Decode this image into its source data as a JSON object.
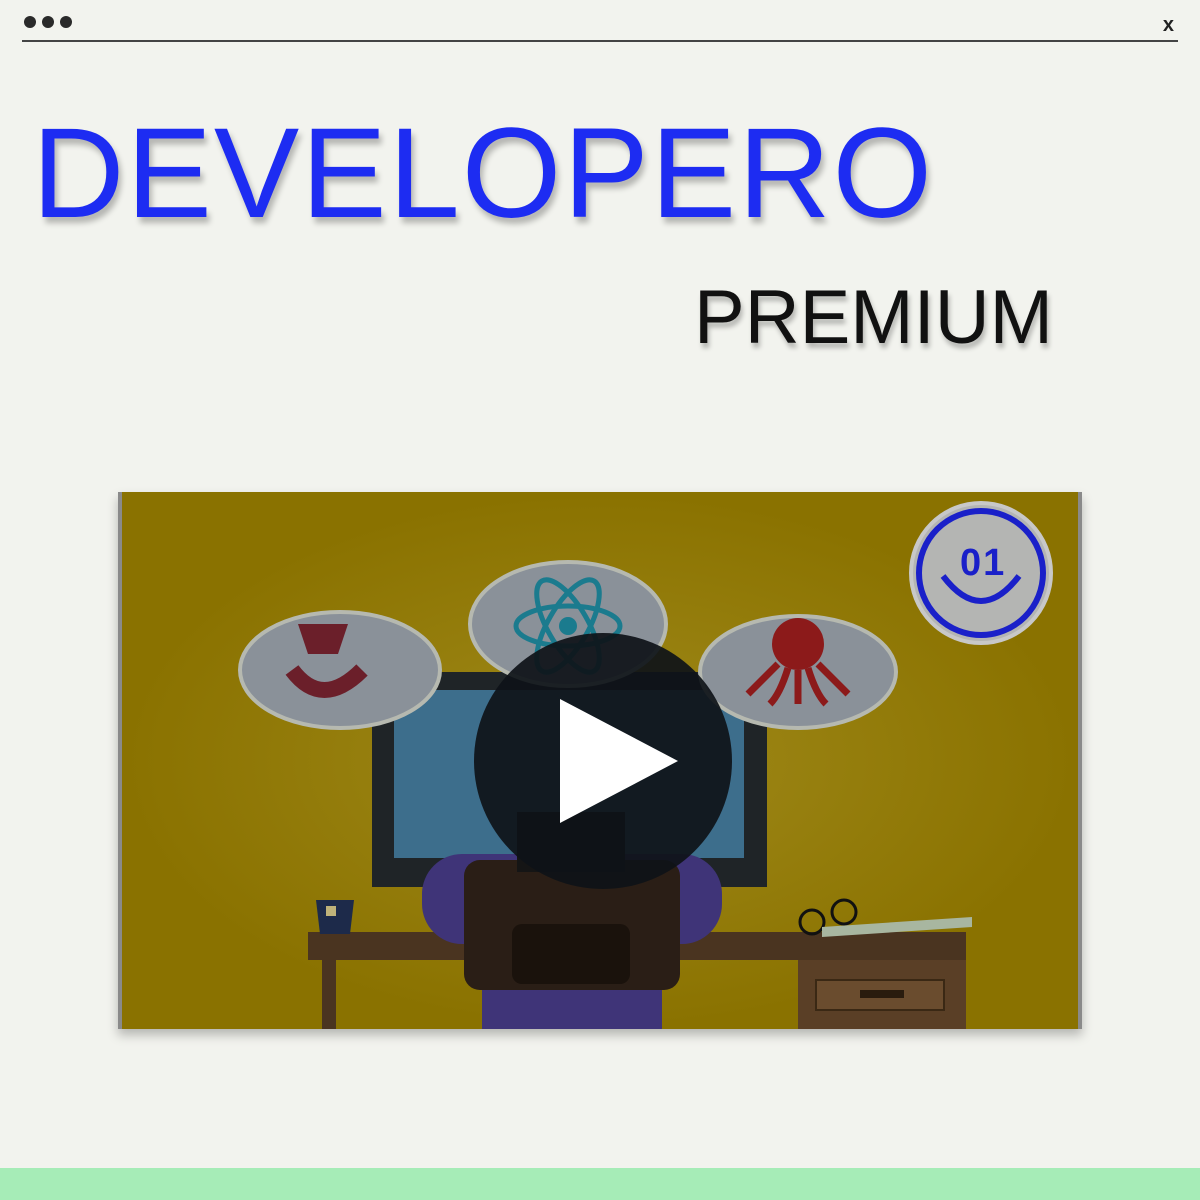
{
  "window": {
    "close_label": "x"
  },
  "hero": {
    "title": "DEVELOPERO",
    "subtitle": "PREMIUM"
  },
  "video": {
    "badge": "01"
  },
  "colors": {
    "brand": "#1d2cf2",
    "video_bg": "#8a7200",
    "footer": "#a6ecb7"
  }
}
